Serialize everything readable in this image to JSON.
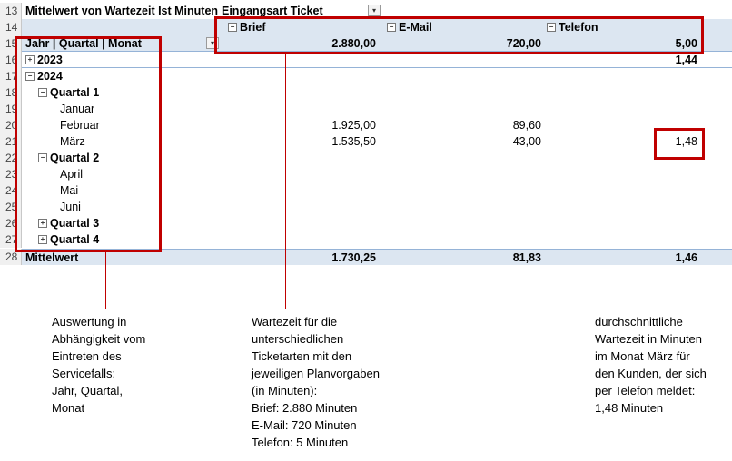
{
  "row_numbers": [
    "13",
    "14",
    "15",
    "16",
    "17",
    "18",
    "19",
    "20",
    "21",
    "22",
    "23",
    "24",
    "25",
    "26",
    "27",
    "28"
  ],
  "pivot": {
    "title": "Mittelwert von Wartezeit Ist Minuten",
    "column_field": "Eingangsart Ticket",
    "row_field": "Jahr | Quartal | Monat",
    "columns": [
      "Brief",
      "E-Mail",
      "Telefon"
    ],
    "plan_values": [
      "2.880,00",
      "720,00",
      "5,00"
    ],
    "rows": [
      {
        "label": "2023",
        "level": 0,
        "expander": "+",
        "values": [
          "",
          "",
          "1,44"
        ]
      },
      {
        "label": "2024",
        "level": 0,
        "expander": "−",
        "values": [
          "",
          "",
          ""
        ]
      },
      {
        "label": "Quartal 1",
        "level": 1,
        "expander": "−",
        "values": [
          "",
          "",
          ""
        ]
      },
      {
        "label": "Januar",
        "level": 2,
        "expander": "",
        "values": [
          "",
          "",
          ""
        ]
      },
      {
        "label": "Februar",
        "level": 2,
        "expander": "",
        "values": [
          "1.925,00",
          "89,60",
          ""
        ]
      },
      {
        "label": "März",
        "level": 2,
        "expander": "",
        "values": [
          "1.535,50",
          "43,00",
          "1,48"
        ]
      },
      {
        "label": "Quartal 2",
        "level": 1,
        "expander": "−",
        "values": [
          "",
          "",
          ""
        ]
      },
      {
        "label": "April",
        "level": 2,
        "expander": "",
        "values": [
          "",
          "",
          ""
        ]
      },
      {
        "label": "Mai",
        "level": 2,
        "expander": "",
        "values": [
          "",
          "",
          ""
        ]
      },
      {
        "label": "Juni",
        "level": 2,
        "expander": "",
        "values": [
          "",
          "",
          ""
        ]
      },
      {
        "label": "Quartal 3",
        "level": 1,
        "expander": "+",
        "values": [
          "",
          "",
          ""
        ]
      },
      {
        "label": "Quartal 4",
        "level": 1,
        "expander": "+",
        "values": [
          "",
          "",
          ""
        ]
      }
    ],
    "total": {
      "label": "Mittelwert",
      "values": [
        "1.730,25",
        "81,83",
        "1,46"
      ]
    }
  },
  "annotations": {
    "left": "Auswertung in\nAbhängigkeit vom\nEintreten des\nServicefalls:\nJahr, Quartal,\nMonat",
    "middle": "Wartezeit für die\nunterschiedlichen\nTicketarten mit den\njeweiligen Planvorgaben\n(in Minuten):\nBrief: 2.880 Minuten\nE-Mail: 720 Minuten\nTelefon: 5 Minuten",
    "right": "durchschnittliche\nWartezeit in Minuten\nim Monat März für\nden Kunden, der sich\nper Telefon meldet:\n1,48 Minuten"
  },
  "colors": {
    "highlight": "#c00000",
    "header_band": "#dce6f1"
  }
}
